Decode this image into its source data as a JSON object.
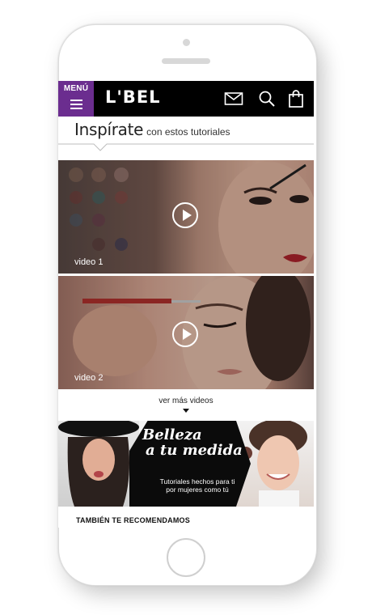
{
  "header": {
    "menu_label": "MENÚ",
    "brand": "L'BEL",
    "icons": [
      "mail-icon",
      "search-icon",
      "shopping-bag-icon",
      "hamburger-icon"
    ]
  },
  "section": {
    "title_big": "Inspírate",
    "title_small": "con estos tutoriales"
  },
  "videos": [
    {
      "label": "video 1"
    },
    {
      "label": "video 2"
    }
  ],
  "more_videos_label": "ver más videos",
  "promo": {
    "script_line1": "Belleza",
    "script_line2": "a tu medida",
    "sub_line1": "Tutoriales hechos para ti",
    "sub_line2": "por mujeres como tú"
  },
  "recommend_label": "TAMBIÉN TE RECOMENDAMOS",
  "colors": {
    "menu_background": "#6b2d8f",
    "header_background": "#000000"
  }
}
